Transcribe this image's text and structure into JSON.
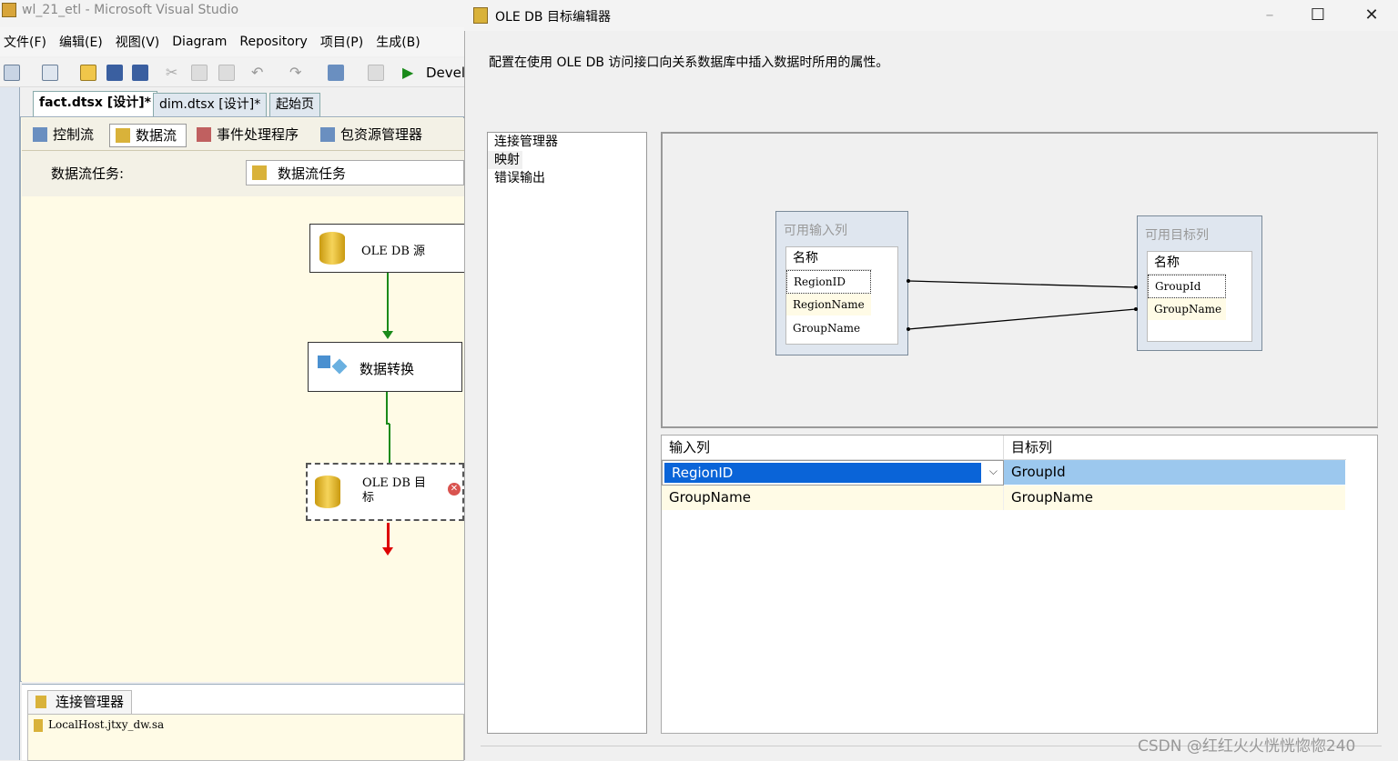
{
  "vs": {
    "title": "wl_21_etl - Microsoft Visual Studio",
    "menu": [
      "文件(F)",
      "编辑(E)",
      "视图(V)",
      "Diagram",
      "Repository",
      "项目(P)",
      "生成(B)"
    ],
    "toolbar_text": "Devel",
    "tabs": [
      "fact.dtsx [设计]*",
      "dim.dtsx [设计]*",
      "起始页"
    ],
    "subtabs": [
      "控制流",
      "数据流",
      "事件处理程序",
      "包资源管理器"
    ],
    "task_label": "数据流任务:",
    "task_value": "数据流任务",
    "components": {
      "source": "OLE DB 源",
      "transform": "数据转换",
      "dest_line1": "OLE DB 目",
      "dest_line2": "标"
    },
    "conn_manager_tab": "连接管理器",
    "conn_item": "LocalHost.jtxy_dw.sa"
  },
  "dialog": {
    "title": "OLE DB 目标编辑器",
    "description": "配置在使用 OLE DB 访问接口向关系数据库中插入数据时所用的属性。",
    "nav": [
      "连接管理器",
      "映射",
      "错误输出"
    ],
    "input_box": {
      "title": "可用输入列",
      "header": "名称",
      "rows": [
        "RegionID",
        "RegionName",
        "GroupName"
      ]
    },
    "dest_box": {
      "title": "可用目标列",
      "header": "名称",
      "rows": [
        "GroupId",
        "GroupName"
      ]
    },
    "grid": {
      "headers": [
        "输入列",
        "目标列"
      ],
      "rows": [
        {
          "input": "RegionID",
          "dest": "GroupId"
        },
        {
          "input": "GroupName",
          "dest": "GroupName"
        }
      ]
    }
  },
  "watermark": "CSDN @红红火火恍恍惚惚240"
}
